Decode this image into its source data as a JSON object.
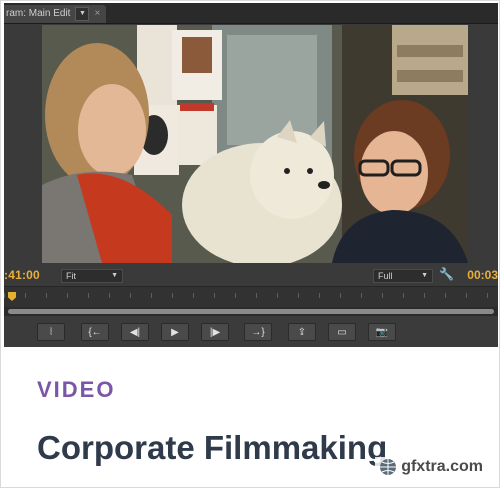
{
  "monitor": {
    "tab_label": "ram: Main Edit",
    "tab_menu_glyph": "▼",
    "close_glyph": "×",
    "timecode_current": ":41:00",
    "timecode_duration": "00:03",
    "fit_select": "Fit",
    "full_select": "Full",
    "caret_glyph": "▼",
    "colors": {
      "timecode": "#e8b03a",
      "panel": "#3a3a3a"
    }
  },
  "controls": [
    {
      "name": "mark-in-button",
      "glyph": "⦚",
      "icon": "mark-in-icon"
    },
    {
      "name": "go-to-in-button",
      "glyph": "{←",
      "icon": "go-to-in-icon"
    },
    {
      "name": "step-back-button",
      "glyph": "◀|",
      "icon": "step-back-icon"
    },
    {
      "name": "play-button",
      "glyph": "▶",
      "icon": "play-icon"
    },
    {
      "name": "step-forward-button",
      "glyph": "|▶",
      "icon": "step-forward-icon"
    },
    {
      "name": "go-to-out-button",
      "glyph": "→}",
      "icon": "go-to-out-icon"
    },
    {
      "name": "lift-button",
      "glyph": "⇪",
      "icon": "lift-icon"
    },
    {
      "name": "safe-margins-button",
      "glyph": "▭",
      "icon": "safe-margins-icon"
    },
    {
      "name": "export-frame-button",
      "glyph": "📷",
      "icon": "camera-icon"
    }
  ],
  "card": {
    "category": "VIDEO",
    "title": "Corporate Filmmaking",
    "category_color": "#7b56a8"
  },
  "watermark": {
    "text": "gfxtra.com"
  }
}
